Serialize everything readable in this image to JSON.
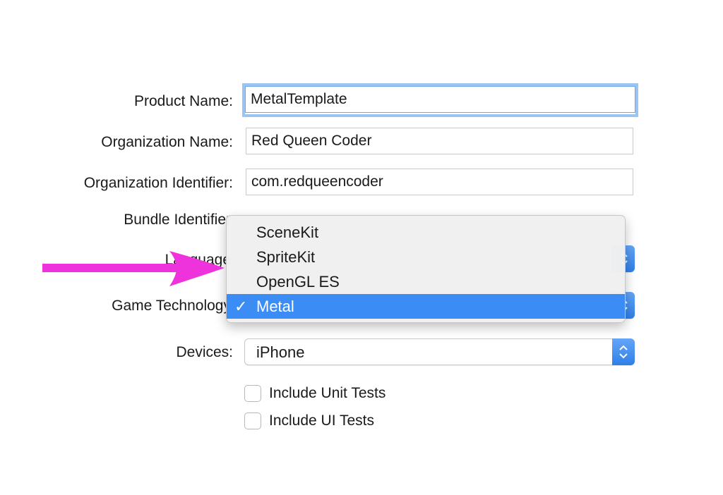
{
  "form": {
    "product_name": {
      "label": "Product Name:",
      "value": "MetalTemplate"
    },
    "organization_name": {
      "label": "Organization Name:",
      "value": "Red Queen Coder"
    },
    "organization_identifier": {
      "label": "Organization Identifier:",
      "value": "com.redqueencoder"
    },
    "bundle_identifier": {
      "label": "Bundle Identifier"
    },
    "language": {
      "label": "Language"
    },
    "game_technology": {
      "label": "Game Technology"
    },
    "devices": {
      "label": "Devices:",
      "value": "iPhone"
    },
    "include_unit_tests": {
      "label": "Include Unit Tests",
      "checked": false
    },
    "include_ui_tests": {
      "label": "Include UI Tests",
      "checked": false
    }
  },
  "game_technology_menu": {
    "items": [
      "SceneKit",
      "SpriteKit",
      "OpenGL ES",
      "Metal"
    ],
    "selected": "Metal",
    "check_glyph": "✓"
  },
  "annotation": {
    "arrow_color": "#ee33dd",
    "icon": "arrow-right-icon"
  },
  "colors": {
    "focus_ring": "#9bc4f3",
    "selection": "#3b8cf5",
    "stepper": "#2f7fe8"
  }
}
